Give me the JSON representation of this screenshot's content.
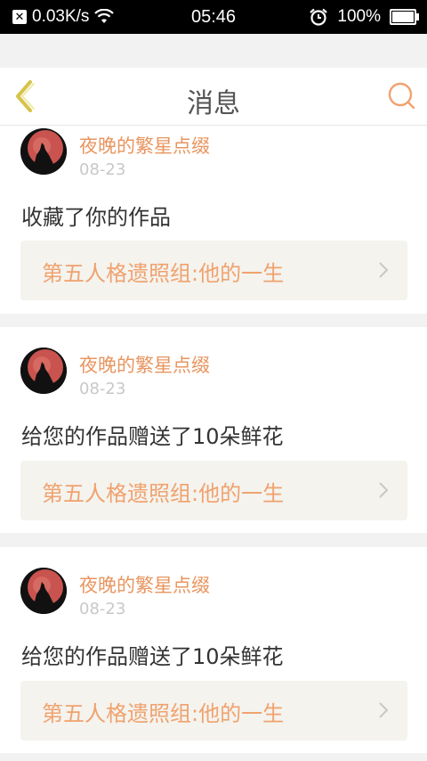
{
  "status_bar": {
    "net_speed": "0.03K/s",
    "time": "05:46",
    "battery": "100%",
    "icons": [
      "notification-x-icon",
      "wifi-icon",
      "alarm-icon",
      "battery-icon"
    ]
  },
  "header": {
    "title": "消息",
    "back_icon": "chevron-left-icon",
    "search_icon": "search-icon",
    "accent": "#e8955f"
  },
  "messages": [
    {
      "user": "夜晚的繁星点缀",
      "date": "08-23",
      "action": "收藏了你的作品",
      "work_title": "第五人格遗照组:他的一生"
    },
    {
      "user": "夜晚的繁星点缀",
      "date": "08-23",
      "action": "给您的作品赠送了10朵鲜花",
      "work_title": "第五人格遗照组:他的一生"
    },
    {
      "user": "夜晚的繁星点缀",
      "date": "08-23",
      "action": "给您的作品赠送了10朵鲜花",
      "work_title": "第五人格遗照组:他的一生"
    }
  ]
}
